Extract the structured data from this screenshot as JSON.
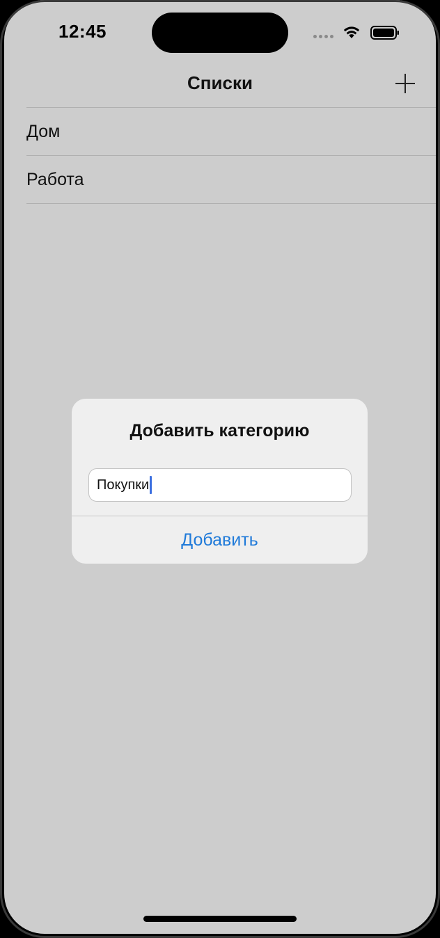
{
  "status_bar": {
    "time": "12:45",
    "icons": [
      "cellular-signal-icon",
      "wifi-icon",
      "battery-icon"
    ]
  },
  "nav": {
    "title": "Списки",
    "add_icon": "plus-icon"
  },
  "list": {
    "items": [
      {
        "label": "Дом"
      },
      {
        "label": "Работа"
      }
    ]
  },
  "alert": {
    "title": "Добавить категорию",
    "field_value": "Покупки",
    "action_label": "Добавить"
  },
  "colors": {
    "background": "#cdcdcd",
    "alert_background": "#efefef",
    "accent": "#1f7ad9",
    "caret": "#3b6fe0"
  }
}
